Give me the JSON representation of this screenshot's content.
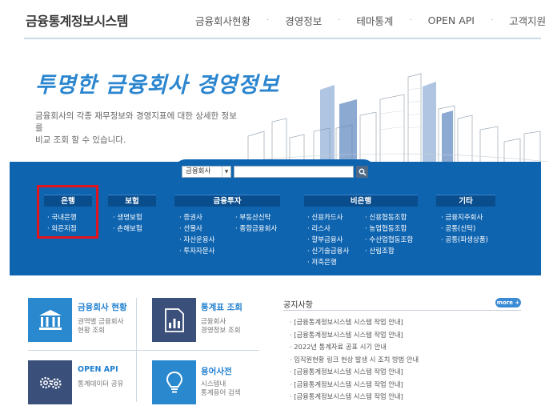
{
  "header": {
    "logo": "금융통계정보시스템",
    "nav": [
      "금융회사현황",
      "경영정보",
      "테마통계",
      "OPEN API",
      "고객지원"
    ],
    "separator": "·"
  },
  "hero": {
    "title": "투명한 금융회사 경영정보",
    "desc_line1": "금융회사의 각종 재무정보와 경영지표에 대한 상세한 정보를",
    "desc_line2": "비교 조회 할 수 있습니다."
  },
  "search": {
    "select_value": "금융회사",
    "input_value": ""
  },
  "categories": [
    {
      "id": "bank",
      "title": "은행",
      "columns": [
        [
          "· 국내은행",
          "· 외은지점"
        ]
      ]
    },
    {
      "id": "insurance",
      "title": "보험",
      "columns": [
        [
          "· 생명보험",
          "· 손해보험"
        ]
      ]
    },
    {
      "id": "invest",
      "title": "금융투자",
      "columns": [
        [
          "· 증권사",
          "· 선물사",
          "· 자산운용사",
          "· 투자자문사"
        ],
        [
          "· 부동산신탁",
          "· 종합금융회사"
        ]
      ]
    },
    {
      "id": "nonbank",
      "title": "비은행",
      "columns": [
        [
          "· 신용카드사",
          "· 리스사",
          "· 할부금융사",
          "· 신기술금융사",
          "· 저축은행"
        ],
        [
          "· 신용협동조합",
          "· 농업협동조합",
          "· 수산업협동조합",
          "· 산림조합"
        ]
      ]
    },
    {
      "id": "etc",
      "title": "기타",
      "columns": [
        [
          "· 금융지주회사",
          "· 공통(신탁)",
          "· 공통(파생상품)"
        ]
      ]
    }
  ],
  "boxes": [
    {
      "id": "company-status",
      "title": "금융회사 현황",
      "desc": [
        "권역별 금융회사",
        "현황 조회"
      ],
      "icon": "bank-building-icon"
    },
    {
      "id": "stat-table",
      "title": "통계표 조회",
      "desc": [
        "금융회사",
        "경영정보 조회"
      ],
      "icon": "chart-document-icon"
    },
    {
      "id": "open-api",
      "title": "OPEN API",
      "desc": [
        "통계데이터 공유"
      ],
      "icon": "gears-icon"
    },
    {
      "id": "glossary",
      "title": "용어사전",
      "desc": [
        "시스템내",
        "통계용어 검색"
      ],
      "icon": "lightbulb-icon"
    }
  ],
  "notice": {
    "title": "공지사항",
    "more": "more +",
    "items": [
      "· [금융통계정보시스템 시스템 작업 안내]",
      "· [금융통계정보시스템 시스템 작업 안내]",
      "· 2022년 통계자료 공표 시기 안내",
      "· 임직원현황 링크 현상 발생 시 조치 방법 안내",
      "· [금융통계정보시스템 시스템 작업 안내]",
      "· [금융통계정보시스템 시스템 작업 안내]",
      "· [금융통계정보시스템 시스템 작업 안내]"
    ]
  },
  "colors": {
    "panel_blue": "#0f64b0",
    "header_blue": "#0a4d8c",
    "accent": "#1f7fcf",
    "highlight_red": "#e0141e",
    "tile_blue": "#2a88cf",
    "tile_navy": "#3a4f7a"
  }
}
